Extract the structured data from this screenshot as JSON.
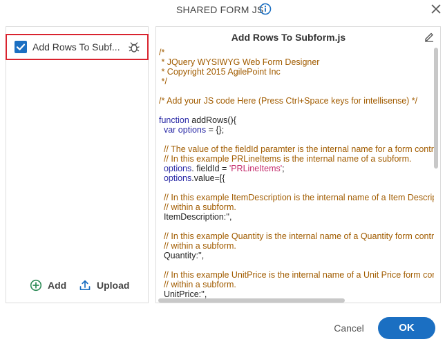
{
  "dialog": {
    "title": "SHARED FORM JS"
  },
  "files": [
    {
      "label": "Add Rows To Subf...",
      "checked": true
    }
  ],
  "left_actions": {
    "add_label": "Add",
    "upload_label": "Upload"
  },
  "editor": {
    "title": "Add Rows To Subform.js",
    "code_lines": [
      [
        {
          "t": "/*",
          "c": "comment"
        }
      ],
      [
        {
          "t": " * JQuery WYSIWYG Web Form Designer",
          "c": "comment"
        }
      ],
      [
        {
          "t": " * Copyright 2015 AgilePoint Inc",
          "c": "comment"
        }
      ],
      [
        {
          "t": " */",
          "c": "comment"
        }
      ],
      [],
      [
        {
          "t": "/* Add your JS code Here (Press Ctrl+Space keys for intellisense) */",
          "c": "comment"
        }
      ],
      [],
      [
        {
          "t": "function",
          "c": "keyword"
        },
        {
          "t": " addRows(){",
          "c": "plain"
        }
      ],
      [
        {
          "t": "  var",
          "c": "keyword"
        },
        {
          "t": " ",
          "c": "plain"
        },
        {
          "t": "options",
          "c": "keyword"
        },
        {
          "t": " = {};",
          "c": "plain"
        }
      ],
      [],
      [
        {
          "t": "  // The value of the fieldId paramter is the internal name for a form control.",
          "c": "comment"
        }
      ],
      [
        {
          "t": "  // In this example PRLineItems is the internal name of a subform.",
          "c": "comment"
        }
      ],
      [
        {
          "t": "  options",
          "c": "keyword"
        },
        {
          "t": ". fieldId = ",
          "c": "plain"
        },
        {
          "t": "'PRLineItems'",
          "c": "string"
        },
        {
          "t": ";",
          "c": "plain"
        }
      ],
      [
        {
          "t": "  options",
          "c": "keyword"
        },
        {
          "t": ".value=[{",
          "c": "plain"
        }
      ],
      [],
      [
        {
          "t": "  // In this example ItemDescription is the internal name of a Item Description field",
          "c": "comment"
        }
      ],
      [
        {
          "t": "  // within a subform.",
          "c": "comment"
        }
      ],
      [
        {
          "t": "  ItemDescription:'',",
          "c": "plain"
        }
      ],
      [],
      [
        {
          "t": "  // In this example Quantity is the internal name of a Quantity form control",
          "c": "comment"
        }
      ],
      [
        {
          "t": "  // within a subform.",
          "c": "comment"
        }
      ],
      [
        {
          "t": "  Quantity:'',",
          "c": "plain"
        }
      ],
      [],
      [
        {
          "t": "  // In this example UnitPrice is the internal name of a Unit Price form control",
          "c": "comment"
        }
      ],
      [
        {
          "t": "  // within a subform.",
          "c": "comment"
        }
      ],
      [
        {
          "t": "  UnitPrice:'',",
          "c": "plain"
        }
      ]
    ]
  },
  "footer": {
    "cancel_label": "Cancel",
    "ok_label": "OK"
  },
  "icons": {
    "info": "info-circle-icon",
    "close": "close-icon",
    "checkbox": "checkmark-icon",
    "debug": "bug-icon",
    "add": "plus-circle-icon",
    "upload": "upload-icon",
    "edit": "pencil-icon"
  },
  "colors": {
    "accent": "#1b6fc2",
    "selection_border": "#d9232e",
    "comment": "#a15c00",
    "keyword": "#2a2aa6",
    "string": "#c42b6b",
    "add_icon": "#2e8b57"
  }
}
